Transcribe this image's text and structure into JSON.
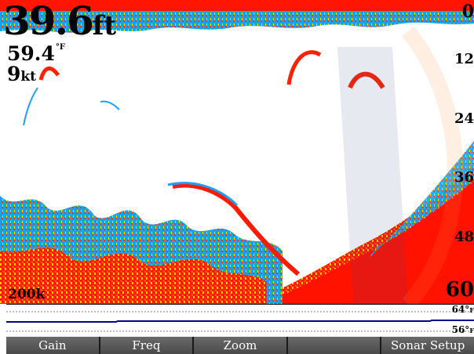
{
  "readouts": {
    "depth": {
      "value": "39.6",
      "unit": "ft"
    },
    "water_temp": {
      "value": "59.4",
      "unit": "°F"
    },
    "speed": {
      "value": "9",
      "unit": "kt"
    },
    "frequency": "200k"
  },
  "depth_scale": {
    "labels": [
      "0",
      "12",
      "24",
      "36",
      "48",
      "60"
    ]
  },
  "temp_graph": {
    "high": {
      "value": "64°",
      "unit": "F"
    },
    "low": {
      "value": "56°",
      "unit": "F"
    }
  },
  "softkeys": [
    {
      "label": "Gain"
    },
    {
      "label": "Freq"
    },
    {
      "label": "Zoom"
    },
    {
      "label": ""
    },
    {
      "label": "Sonar Setup"
    }
  ],
  "colors": {
    "bottom_return": "#ff0000",
    "strong_return": "#ff2200",
    "medium_return": "#ffcc00",
    "weak_return": "#00aaff",
    "trace_line": "#00008b"
  }
}
